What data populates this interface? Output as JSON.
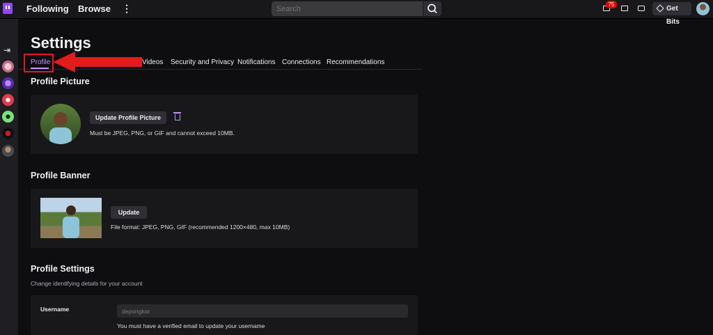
{
  "topbar": {
    "nav": [
      "Following",
      "Browse"
    ],
    "search_placeholder": "Search",
    "notification_count": "75",
    "get_bits_label": "Get Bits"
  },
  "settings": {
    "title": "Settings",
    "tabs": [
      "Profile",
      "Videos",
      "Security and Privacy",
      "Notifications",
      "Connections",
      "Recommendations"
    ],
    "active_tab": "Profile",
    "profile_picture": {
      "title": "Profile Picture",
      "button": "Update Profile Picture",
      "hint": "Must be JPEG, PNG, or GIF and cannot exceed 10MB."
    },
    "profile_banner": {
      "title": "Profile Banner",
      "button": "Update",
      "hint": "File format: JPEG, PNG, GIF (recommended 1200×480, max 10MB)"
    },
    "profile_settings": {
      "title": "Profile Settings",
      "subtitle": "Change identifying details for your account",
      "username_label": "Username",
      "username_value": "depongkar",
      "username_hint": "You must have a verified email to update your username"
    }
  },
  "colors": {
    "accent": "#bf94ff",
    "brand": "#9147ff",
    "annotation_red": "#e21b1b",
    "badge": "#eb0400",
    "background": "#0e0e10",
    "card": "#18181b"
  }
}
